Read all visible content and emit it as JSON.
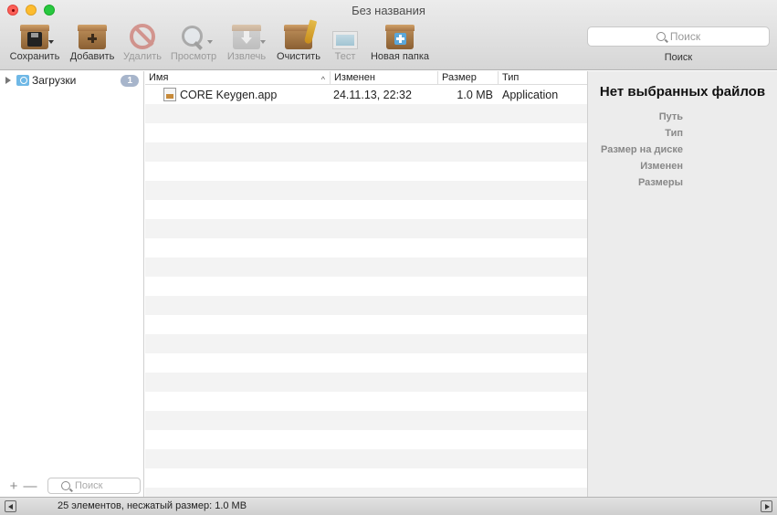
{
  "window": {
    "title": "Без названия"
  },
  "toolbar": {
    "save": "Сохранить",
    "add": "Добавить",
    "delete": "Удалить",
    "preview": "Просмотр",
    "extract": "Извлечь",
    "clean": "Очистить",
    "test": "Тест",
    "new_folder": "Новая папка",
    "search_placeholder": "Поиск",
    "search_label": "Поиск"
  },
  "sidebar": {
    "items": [
      {
        "label": "Загрузки",
        "badge": "1",
        "icon": "downloads-folder-icon"
      }
    ],
    "add_button": "+",
    "remove_button": "—",
    "search_placeholder": "Поиск"
  },
  "filelist": {
    "columns": {
      "name": "Имя",
      "modified": "Изменен",
      "size": "Размер",
      "type": "Тип"
    },
    "sort_indicator": "^",
    "rows": [
      {
        "name": "CORE Keygen.app",
        "modified": "24.11.13, 22:32",
        "size": "1.0 MB",
        "type": "Application"
      }
    ]
  },
  "info": {
    "title": "Нет выбранных файлов",
    "fields": [
      "Путь",
      "Тип",
      "Размер на диске",
      "Изменен",
      "Размеры"
    ]
  },
  "status": {
    "text": "25 элементов, несжатый размер: 1.0 MB"
  }
}
